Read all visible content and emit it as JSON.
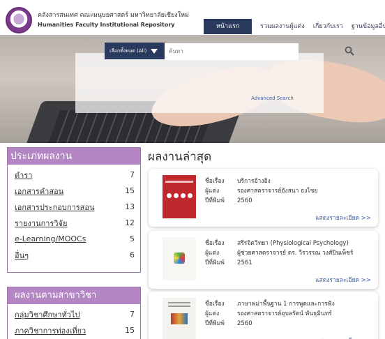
{
  "header": {
    "title_th": "คลังสารสนเทศ คณะมนุษยศาสตร์ มหาวิทยาลัยเชียงใหม่",
    "title_en": "Humanities Faculty Institutional Repository",
    "nav": [
      "หน้าแรก",
      "รวมผลงานผู้แต่ง",
      "เกี่ยวกับเรา",
      "ฐานข้อมูลอื่นๆ"
    ]
  },
  "search": {
    "scope": "เลือกทั้งหมด (All)",
    "placeholder": "ค้นหา",
    "advanced": "Advanced Search"
  },
  "categories": {
    "title": "ประเภทผลงาน",
    "items": [
      {
        "label": "ตำรา",
        "count": "7"
      },
      {
        "label": "เอกสารคำสอน",
        "count": "15"
      },
      {
        "label": "เอกสารประกอบการสอน",
        "count": "13"
      },
      {
        "label": "รายงานการวิจัย",
        "count": "12"
      },
      {
        "label": "e-Learning/MOOCs",
        "count": "5"
      },
      {
        "label": "อื่นๆ",
        "count": "6"
      }
    ]
  },
  "departments": {
    "title": "ผลงานตามสาขาวิชา",
    "items": [
      {
        "label": "กลุ่มวิชาศึกษาทั่วไป",
        "count": "7"
      },
      {
        "label": "ภาควิชาการท่องเที่ยว",
        "count": "15"
      }
    ]
  },
  "latest": {
    "title": "ผลงานล่าสุด",
    "labels": {
      "title": "ชื่อเรื่อง",
      "author": "ผู้แต่ง",
      "year": "ปีที่พิมพ์",
      "detail": "แสดงรายละเอียด >>"
    },
    "items": [
      {
        "title": "บริการอ้างอิง",
        "author": "รองศาสตราจารย์อังสนา ธงไชย",
        "year": "2560"
      },
      {
        "title": "สรีรจิตวิทยา (Physiological Psychology)",
        "author": "ผู้ช่วยศาสตราจารย์ ดร. วีรวรรณ วงศ์ปินเพ็ชร์",
        "year": "2561"
      },
      {
        "title": "ภาษาพม่าพื้นฐาน 1 การพูดและการฟัง",
        "author": "รองศาสตราจารย์อุบลรัตน์ พันธุมินทร์",
        "year": "2560"
      }
    ]
  }
}
